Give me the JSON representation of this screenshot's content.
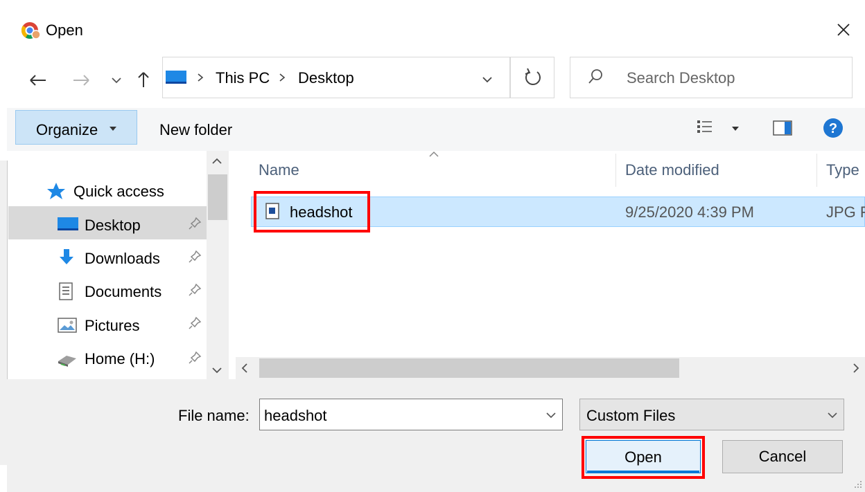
{
  "window": {
    "title": "Open"
  },
  "address": {
    "crumbs": [
      "This PC",
      "Desktop"
    ]
  },
  "search": {
    "placeholder": "Search Desktop"
  },
  "toolbar": {
    "organize_label": "Organize",
    "new_folder_label": "New folder"
  },
  "nav": {
    "quick_access": "Quick access",
    "items": [
      {
        "label": "Desktop",
        "icon": "desktop-icon",
        "pinned": true
      },
      {
        "label": "Downloads",
        "icon": "downloads-icon",
        "pinned": true
      },
      {
        "label": "Documents",
        "icon": "documents-icon",
        "pinned": true
      },
      {
        "label": "Pictures",
        "icon": "pictures-icon",
        "pinned": true
      },
      {
        "label": "Home (H:)",
        "icon": "drive-icon",
        "pinned": true
      }
    ]
  },
  "file_list": {
    "columns": [
      "Name",
      "Date modified",
      "Type"
    ],
    "rows": [
      {
        "name": "headshot",
        "date": "9/25/2020 4:39 PM",
        "type": "JPG F"
      }
    ]
  },
  "bottom": {
    "file_name_label": "File name:",
    "file_name_value": "headshot",
    "file_type_value": "Custom Files",
    "open_label": "Open",
    "cancel_label": "Cancel"
  },
  "colors": {
    "selection": "#cce8ff",
    "accent": "#0078d7",
    "highlight_annotation": "#ff0000",
    "help": "#1e76d2"
  }
}
